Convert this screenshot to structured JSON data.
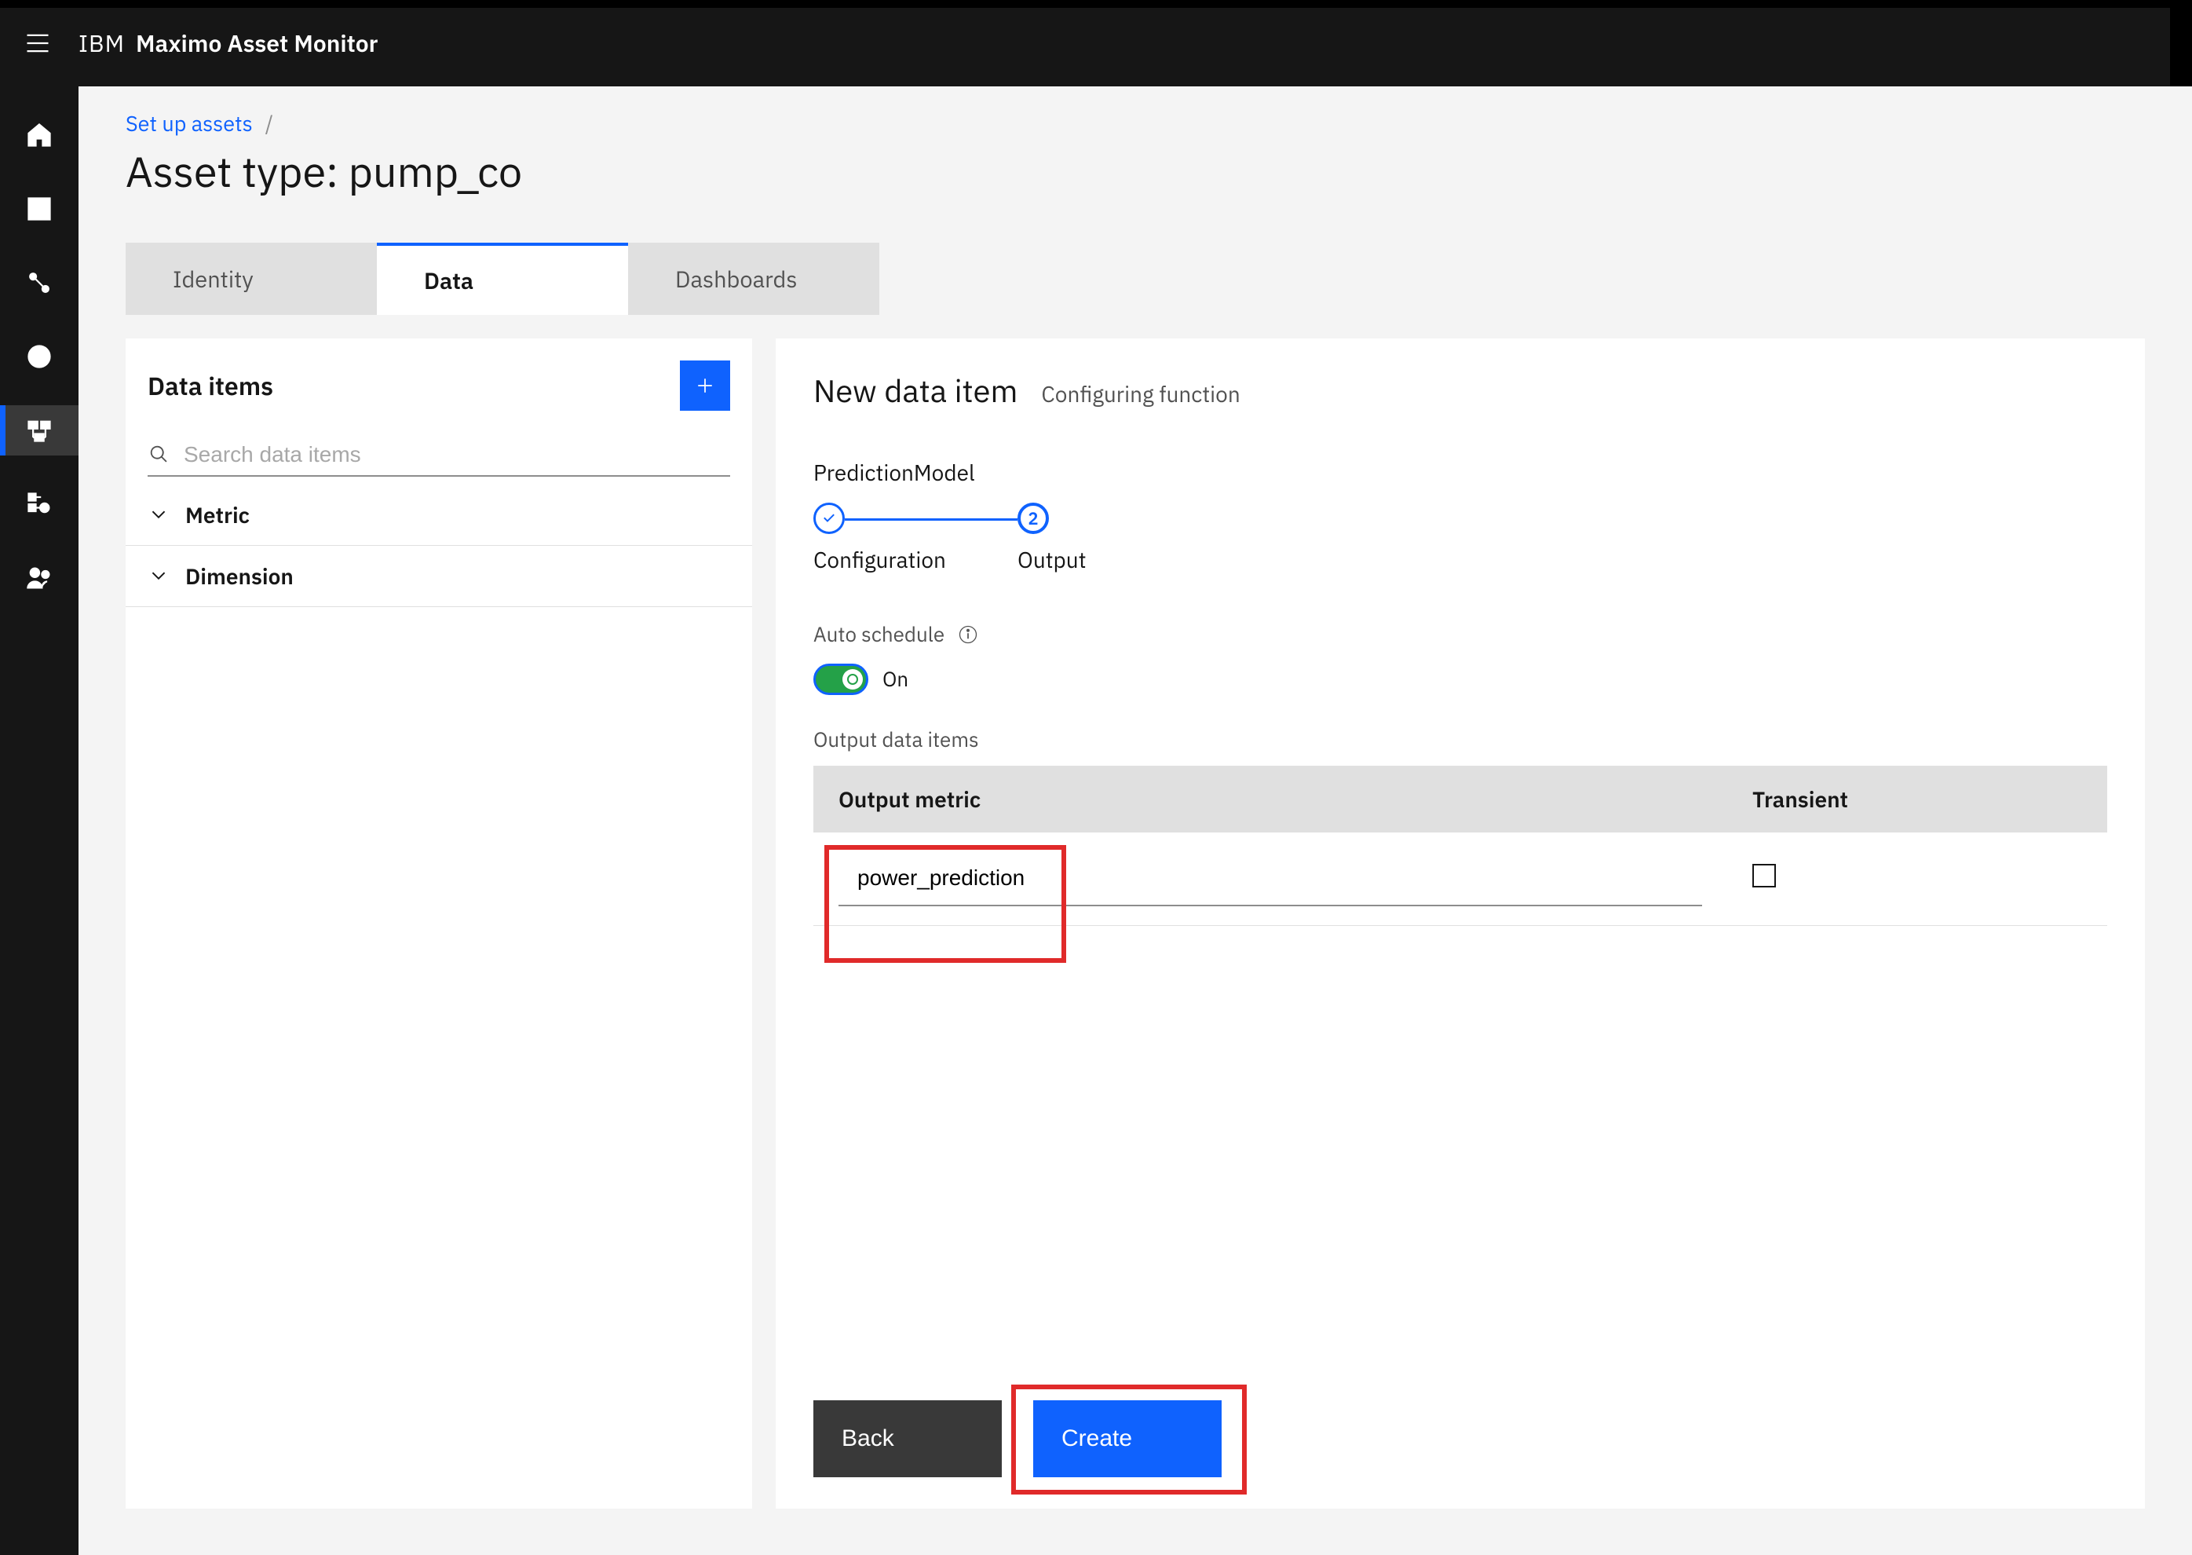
{
  "app": {
    "brand_prefix": "IBM",
    "brand_name": "Maximo Asset Monitor"
  },
  "breadcrumb": {
    "root": "Set up assets",
    "separator": "/"
  },
  "page_title": "Asset type: pump_co",
  "tabs": [
    {
      "label": "Identity",
      "selected": false
    },
    {
      "label": "Data",
      "selected": true
    },
    {
      "label": "Dashboards",
      "selected": false
    }
  ],
  "left_panel": {
    "title": "Data items",
    "search_placeholder": "Search data items",
    "items": [
      {
        "label": "Metric"
      },
      {
        "label": "Dimension"
      }
    ]
  },
  "right_panel": {
    "title": "New data item",
    "subtitle": "Configuring function",
    "model_name": "PredictionModel",
    "steps": [
      {
        "label": "Configuration",
        "state": "complete"
      },
      {
        "label": "Output",
        "state": "current",
        "num": "2"
      }
    ],
    "auto_schedule_label": "Auto schedule",
    "toggle_state": "On",
    "output_section_label": "Output data items",
    "table": {
      "headers": {
        "metric": "Output metric",
        "transient": "Transient"
      },
      "rows": [
        {
          "metric_value": "power_prediction",
          "transient": false
        }
      ]
    },
    "buttons": {
      "back": "Back",
      "create": "Create"
    }
  },
  "sidenav": {
    "items": [
      "home",
      "dashboards",
      "connections",
      "explore",
      "setup",
      "catalog",
      "users"
    ]
  }
}
